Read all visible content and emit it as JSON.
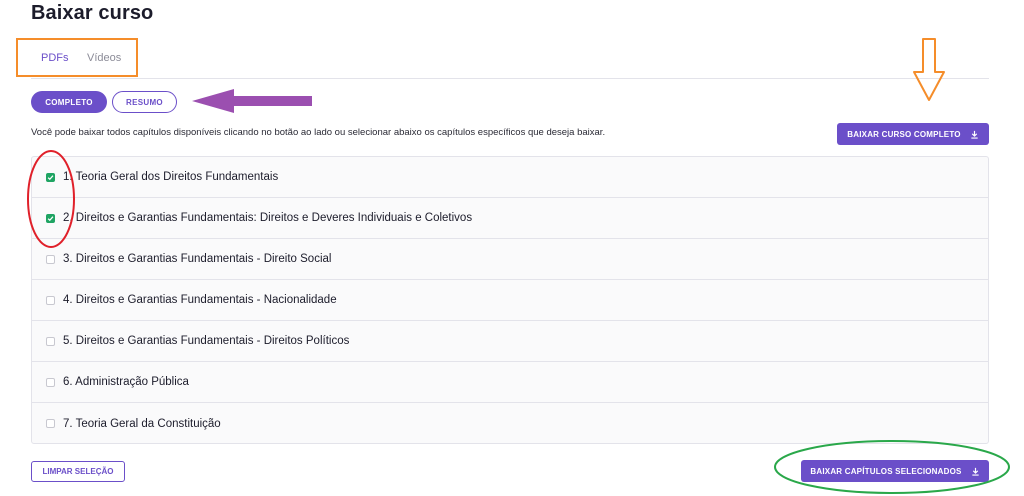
{
  "page": {
    "title": "Baixar curso"
  },
  "tabs": [
    {
      "label": "PDFs",
      "active": true
    },
    {
      "label": "Vídeos",
      "active": false
    }
  ],
  "content_type": {
    "options": [
      {
        "label": "COMPLETO",
        "selected": true
      },
      {
        "label": "RESUMO",
        "selected": false
      }
    ]
  },
  "instructions": "Você pode baixar todos capítulos disponíveis clicando no botão ao lado ou selecionar abaixo os capítulos específicos que deseja baixar.",
  "actions": {
    "download_full_label": "BAIXAR CURSO COMPLETO",
    "download_selected_label": "BAIXAR CAPÍTULOS SELECIONADOS",
    "clear_selection_label": "LIMPAR SELEÇÃO"
  },
  "chapters": [
    {
      "label": "1. Teoria Geral dos Direitos Fundamentais",
      "checked": true
    },
    {
      "label": "2. Direitos e Garantias Fundamentais: Direitos e Deveres Individuais e Coletivos",
      "checked": true
    },
    {
      "label": "3. Direitos e Garantias Fundamentais - Direito Social",
      "checked": false
    },
    {
      "label": "4. Direitos e Garantias Fundamentais - Nacionalidade",
      "checked": false
    },
    {
      "label": "5. Direitos e Garantias Fundamentais - Direitos Políticos",
      "checked": false
    },
    {
      "label": "6. Administração Pública",
      "checked": false
    },
    {
      "label": "7. Teoria Geral da Constituição",
      "checked": false
    }
  ],
  "icons": {
    "download": "download-icon",
    "checkmark": "check-icon"
  },
  "colors": {
    "accent": "#6b4fc9",
    "checked": "#1fa463",
    "annotation_orange": "#f58d2a",
    "annotation_purple": "#9b4fb0",
    "annotation_red": "#e0202a",
    "annotation_green": "#2aa84a"
  }
}
